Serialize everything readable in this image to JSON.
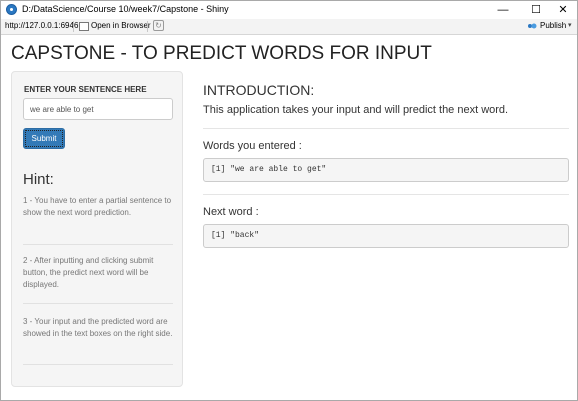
{
  "window": {
    "title": "D:/DataScience/Course 10/week7/Capstone - Shiny",
    "minimize_glyph": "—",
    "maximize_glyph": "☐",
    "close_glyph": "✕"
  },
  "toolbar": {
    "url": "http://127.0.0.1:6946",
    "open_in_browser": "Open in Browser",
    "publish": "Publish",
    "publish_caret": "▾",
    "refresh_glyph": "↻"
  },
  "page": {
    "title": "CAPSTONE - TO PREDICT WORDS FOR INPUT"
  },
  "sidebar": {
    "input_label": "ENTER YOUR SENTENCE HERE",
    "input_value": "we are able to get",
    "submit_label": "Submit",
    "hint_heading": "Hint:",
    "hints": [
      "1 - You have to enter a partial sentence to show the next word prediction.",
      "2 - After inputting and clicking submit button, the predict next word will be displayed.",
      "3 - Your input and the predicted word are showed in the text boxes on the right side."
    ]
  },
  "main": {
    "intro_heading": "INTRODUCTION:",
    "intro_text": "This application takes your input and will predict the next word.",
    "entered_heading": "Words you entered :",
    "entered_output": "[1] \"we are able to get\"",
    "next_heading": "Next word :",
    "next_output": "[1] \"back\""
  },
  "colors": {
    "accent": "#337ab7",
    "sidebar_bg": "#f5f5f5",
    "hint_text": "#777777"
  }
}
